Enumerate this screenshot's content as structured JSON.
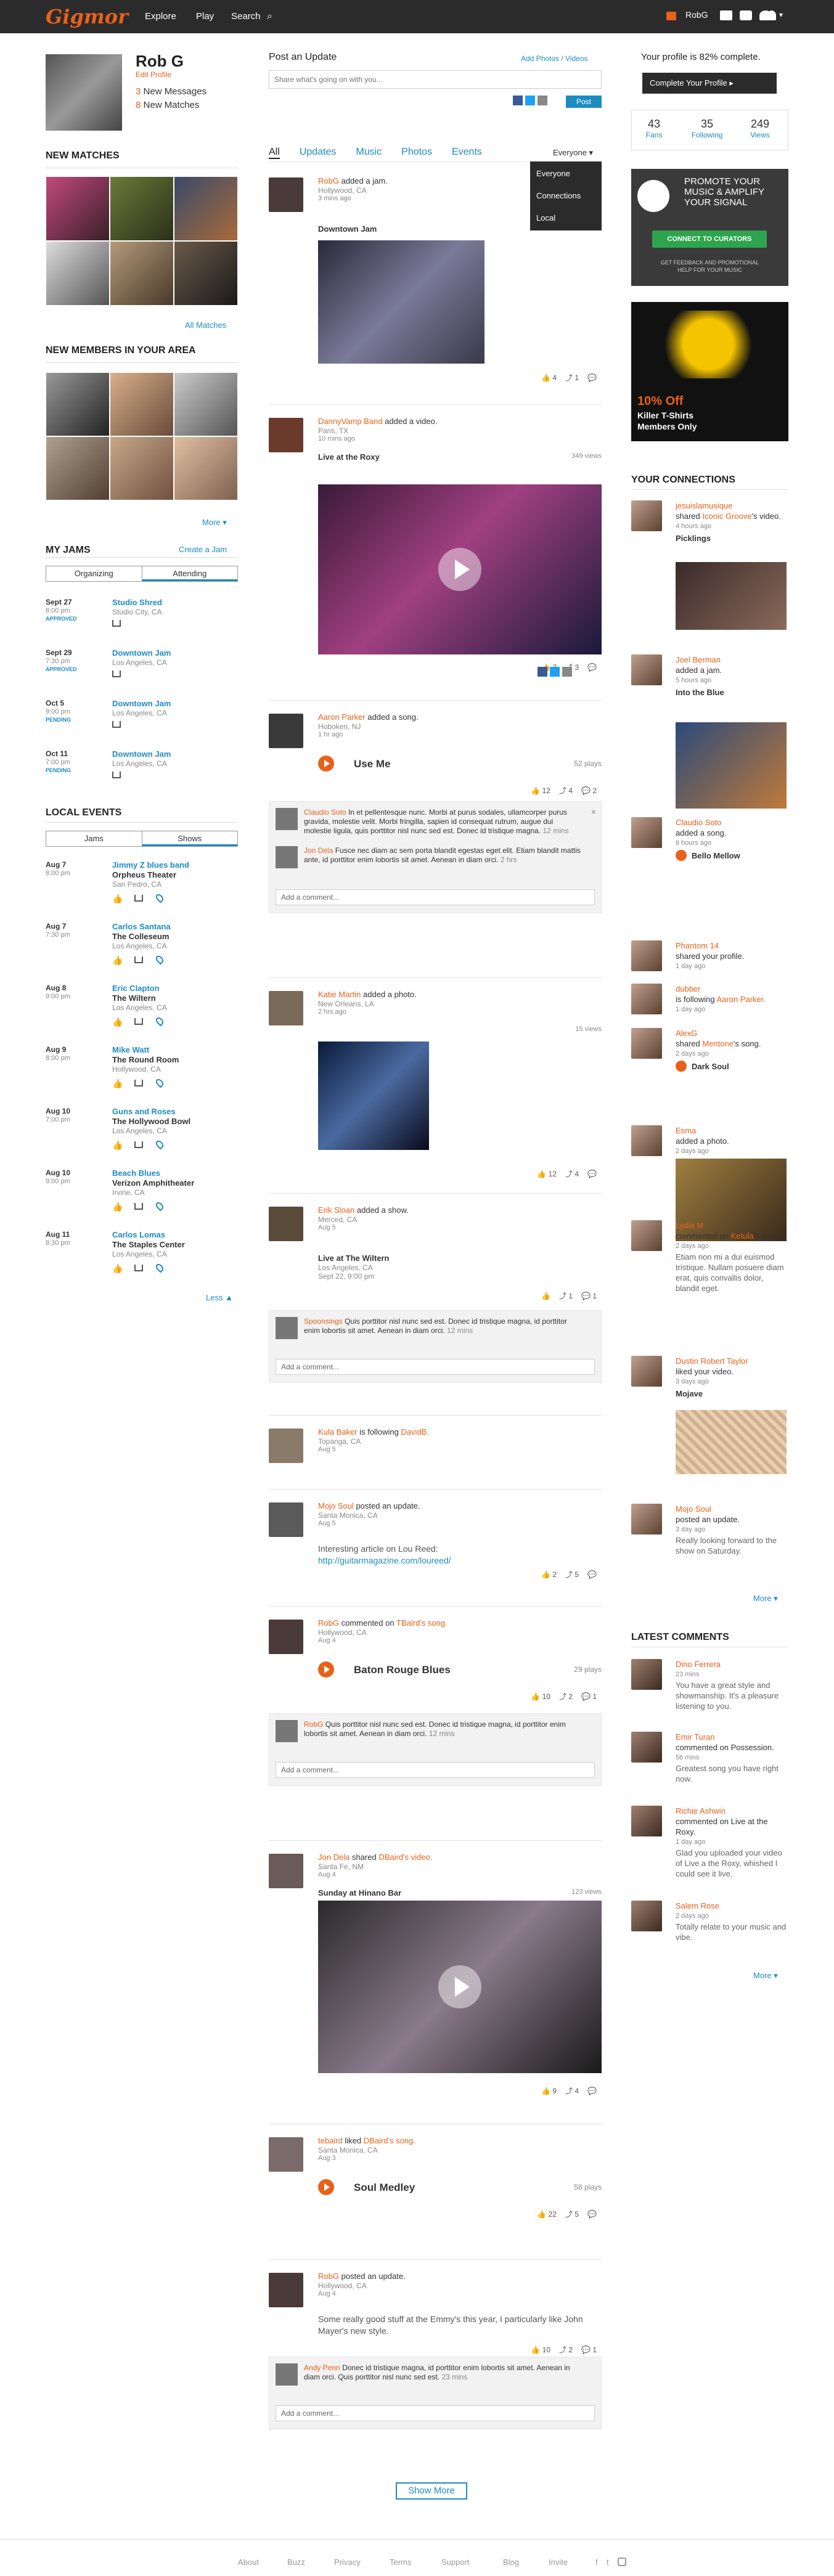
{
  "header": {
    "logo": "Gigmor",
    "nav": [
      "Explore",
      "Play",
      "Search"
    ],
    "user": "RobG"
  },
  "profile": {
    "name": "Rob G",
    "edit": "Edit Profile",
    "msg_count": "3",
    "msg_label": "New Messages",
    "match_count": "8",
    "match_label": "New Matches"
  },
  "left": {
    "new_matches": "NEW MATCHES",
    "all_matches": "All Matches",
    "new_members": "NEW MEMBERS IN YOUR AREA",
    "more": "More ▾",
    "my_jams": "MY JAMS",
    "create_jam": "Create a Jam",
    "jam_tabs": [
      "Organizing",
      "Attending"
    ],
    "jams": [
      {
        "date": "Sept 27",
        "time": "8:00 pm",
        "status": "APPROVED",
        "title": "Studio Shred",
        "loc": "Studio City, CA"
      },
      {
        "date": "Sept 29",
        "time": "7:30 pm",
        "status": "APPROVED",
        "title": "Downtown Jam",
        "loc": "Los Angeles, CA"
      },
      {
        "date": "Oct 5",
        "time": "9:00 pm",
        "status": "PENDING",
        "title": "Downtown Jam",
        "loc": "Los Angeles, CA"
      },
      {
        "date": "Oct 11",
        "time": "7:00 pm",
        "status": "PENDING",
        "title": "Downtown Jam",
        "loc": "Los Angeles, CA"
      }
    ],
    "local_events": "LOCAL EVENTS",
    "event_tabs": [
      "Jams",
      "Shows"
    ],
    "events": [
      {
        "date": "Aug 7",
        "time": "8:00 pm",
        "title": "Jimmy Z blues band",
        "venue": "Orpheus Theater",
        "loc": "San Pedro, CA"
      },
      {
        "date": "Aug 7",
        "time": "7:30 pm",
        "title": "Carlos Santana",
        "venue": "The Colleseum",
        "loc": "Los Angeles, CA"
      },
      {
        "date": "Aug 8",
        "time": "9:00 pm",
        "title": "Eric Clapton",
        "venue": "The Wiltern",
        "loc": "Los Angeles, CA"
      },
      {
        "date": "Aug 9",
        "time": "8:00 pm",
        "title": "Mike Watt",
        "venue": "The Round Room",
        "loc": "Hollywood, CA"
      },
      {
        "date": "Aug 10",
        "time": "7:00 pm",
        "title": "Guns and Roses",
        "venue": "The Hollywood Bowl",
        "loc": "Los Angeles, CA"
      },
      {
        "date": "Aug 10",
        "time": "9:00 pm",
        "title": "Beach Blues",
        "venue": "Verizon Amphitheater",
        "loc": "Irvine, CA"
      },
      {
        "date": "Aug 11",
        "time": "8:30 pm",
        "title": "Carlos Lomas",
        "venue": "The Staples Center",
        "loc": "Los Angeles, CA"
      }
    ],
    "less": "Less ▲"
  },
  "post": {
    "title": "Post an Update",
    "add": "Add Photos / Videos",
    "placeholder": "Share what's going on with you...",
    "button": "Post"
  },
  "filters": [
    "All",
    "Updates",
    "Music",
    "Photos",
    "Events"
  ],
  "audience": {
    "label": "Everyone ▾",
    "options": [
      "Everyone",
      "Connections",
      "Local"
    ]
  },
  "feed": [
    {
      "user": "RobG",
      "verb": "added a jam.",
      "loc": "Hollywood, CA",
      "time": "3 mins ago",
      "title": "Downtown Jam",
      "counts": [
        "4",
        "1",
        ""
      ]
    },
    {
      "user": "DannyVamp Band",
      "verb": "added a video.",
      "loc": "Paris, TX",
      "time": "10 mins ago",
      "title": "Live at the Roxy",
      "views": "349 views",
      "counts": [
        "7",
        "3",
        ""
      ]
    },
    {
      "user": "Aaron Parker",
      "verb": "added a song.",
      "loc": "Hoboken, NJ",
      "time": "1 hr ago",
      "title": "Use Me",
      "plays": "52 plays",
      "counts": [
        "12",
        "4",
        "2"
      ],
      "comments": [
        {
          "user": "Claudio Soto",
          "text": "In et pellentesque nunc. Morbi at purus sodales, ullamcorper purus gravida, molestie velit. Morbi fringilla, sapien id consequat rutrum, augue dui molestie ligula, quis porttitor nisl nunc sed est. Donec id tristique magna.",
          "time": "12 mins"
        },
        {
          "user": "Jon Dela",
          "text": "Fusce nec diam ac sem porta blandit egestas eget elit. Etiam blandit mattis ante, id porttitor enim lobortis sit amet. Aenean in diam orci.",
          "time": "2 hrs"
        }
      ]
    },
    {
      "user": "Katie Martin",
      "verb": "added a photo.",
      "loc": "New Orleans, LA",
      "time": "2 hrs ago",
      "views": "15 views",
      "counts": [
        "12",
        "4",
        ""
      ]
    },
    {
      "user": "Erik Sloan",
      "verb": "added a show.",
      "loc": "Merced, CA",
      "time": "Aug 5",
      "title": "Live at The Wiltern",
      "sub1": "Los Angeles, CA",
      "sub2": "Sept 22, 9:00 pm",
      "counts": [
        "",
        "1",
        "1"
      ],
      "comments": [
        {
          "user": "Spoonsings",
          "text": "Quis porttitor nisl nunc sed est. Donec id tristique magna, id porttitor enim lobortis sit amet. Aenean in diam orci.",
          "time": "12 mins"
        }
      ]
    },
    {
      "user": "Kula Baker",
      "verb": "is following",
      "target": "DavidB.",
      "loc": "Topanga, CA",
      "time": "Aug 5"
    },
    {
      "user": "Mojo Soul",
      "verb": "posted an update.",
      "loc": "Santa Monica, CA",
      "time": "Aug 5",
      "text": "Interesting article on Lou Reed:",
      "link": "http://guitarmagazine.com/loureed/",
      "counts": [
        "2",
        "5",
        ""
      ]
    },
    {
      "user": "RobG",
      "verb": "commented on",
      "target": "TBaird's song.",
      "loc": "Hollywood, CA",
      "time": "Aug 4",
      "title": "Baton Rouge Blues",
      "plays": "29 plays",
      "counts": [
        "10",
        "2",
        "1"
      ],
      "comments": [
        {
          "user": "RobG",
          "text": "Quis porttitor nisl nunc sed est. Donec id tristique magna, id porttitor enim lobortis sit amet. Aenean in diam orci.",
          "time": "12 mins"
        }
      ]
    },
    {
      "user": "Jon Dela",
      "verb": "shared",
      "target": "DBaird's video.",
      "loc": "Santa Fe, NM",
      "time": "Aug 4",
      "title": "Sunday at Hinano Bar",
      "views": "123 views",
      "counts": [
        "9",
        "4",
        ""
      ]
    },
    {
      "user": "tebaird",
      "verb": "liked",
      "target": "DBaird's song.",
      "loc": "Santa Monica, CA",
      "time": "Aug 3",
      "title": "Soul Medley",
      "plays": "58 plays",
      "counts": [
        "22",
        "5",
        ""
      ]
    },
    {
      "user": "RobG",
      "verb": "posted an update.",
      "loc": "Hollywood, CA",
      "time": "Aug 4",
      "text": "Some really good stuff at the Emmy's this year, I particularly like John Mayer's new style.",
      "counts": [
        "10",
        "2",
        "1"
      ],
      "comments": [
        {
          "user": "Andy Penn",
          "text": "Donec id tristique magna, id porttitor enim lobortis sit amet. Aenean in diam orci. Quis porttitor nisl nunc sed est.",
          "time": "23 mins"
        }
      ]
    }
  ],
  "add_comment": "Add a comment...",
  "show_more": "Show More",
  "right": {
    "complete": "Your profile is 82% complete.",
    "complete_btn": "Complete Your Profile ▸",
    "stats": [
      {
        "n": "43",
        "l": "Fans"
      },
      {
        "n": "35",
        "l": "Following"
      },
      {
        "n": "249",
        "l": "Views"
      }
    ],
    "promo": {
      "l1": "PROMOTE YOUR",
      "l2": "MUSIC & AMPLIFY",
      "l3": "YOUR SIGNAL",
      "btn": "CONNECT TO CURATORS",
      "f1": "GET FEEDBACK AND PROMOTIONAL",
      "f2": "HELP FOR YOUR MUSIC"
    },
    "ad": {
      "pct": "10% Off",
      "l1": "Killer T-Shirts",
      "l2": "Members Only"
    },
    "connections_title": "YOUR CONNECTIONS",
    "connections": [
      {
        "user": "jesuislamusique",
        "a": "shared",
        "t": "Iconic Groove",
        "b": "'s video.",
        "time": "4 hours ago",
        "title": "Picklings"
      },
      {
        "user": "Joel Berman",
        "a": "added a jam.",
        "time": "5 hours ago",
        "title": "Into the Blue"
      },
      {
        "user": "Claudio Soto",
        "a": "added a song.",
        "time": "6 hours ago",
        "title": "Bello Mellow"
      },
      {
        "user": "Phantom 14",
        "a": "shared your profile.",
        "time": "1 day ago"
      },
      {
        "user": "dubber",
        "a": "is following",
        "t": "Aaron Parker.",
        "time": "1 day ago"
      },
      {
        "user": "AlexG",
        "a": "shared",
        "t": "Mentone",
        "b": "'s song.",
        "time": "2 days ago",
        "title": "Dark Soul"
      },
      {
        "user": "Esma",
        "a": "added a photo.",
        "time": "2 days ago"
      },
      {
        "user": "Lydia M",
        "a": "commented on",
        "t": "Ketula",
        "b": "'s profile.",
        "time": "2 days ago",
        "text": "Etiam non mi a dui euismod tristique. Nullam posuere diam erat, quis convallis dolor, blandit eget."
      },
      {
        "user": "Dustin Robert Taylor",
        "a": "liked your video.",
        "time": "3 days ago",
        "title": "Mojave"
      },
      {
        "user": "Mojo Soul",
        "a": "posted an update.",
        "time": "3 day ago",
        "text": "Really looking forward to the show on Saturday."
      }
    ],
    "more": "More ▾",
    "latest_title": "LATEST COMMENTS",
    "latest": [
      {
        "user": "Dino Ferrera",
        "time": "23 mins",
        "text": "You have a great style and showmanship. It's a pleasure listening to you."
      },
      {
        "user": "Emir Turan",
        "a": "commented on Possession.",
        "time": "56 mins",
        "text": "Greatest song you have right now."
      },
      {
        "user": "Richie Ashwin",
        "a": "commented on Live at the Roxy.",
        "time": "1 day ago",
        "text": "Glad you uploaded your video of Live a the Roxy, whished I could see it live."
      },
      {
        "user": "Salem Rose",
        "time": "2 days ago",
        "text": "Totally relate to your music and vibe."
      }
    ]
  },
  "footer": [
    "About",
    "Buzz",
    "Privacy",
    "Terms",
    "Support",
    "Blog",
    "Invite"
  ]
}
